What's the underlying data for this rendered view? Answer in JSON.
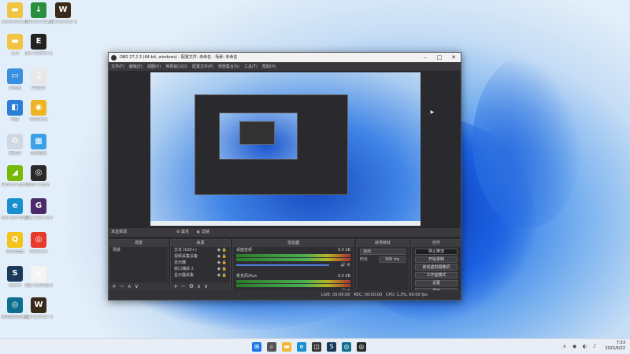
{
  "desktop": {
    "icons": [
      {
        "label": "Administrator",
        "icon": "folder-icon",
        "color": "#f2c443",
        "glyph": "▬"
      },
      {
        "label": "Internet Download...",
        "icon": "idm-icon",
        "color": "#2b8e3e",
        "glyph": "↓"
      },
      {
        "label": "Warhammer Vermintide 2",
        "icon": "game-icon",
        "color": "#3a2a1a",
        "glyph": "W"
      },
      {
        "label": "123",
        "icon": "folder-icon",
        "color": "#f2c443",
        "glyph": "▬"
      },
      {
        "label": "Epic Games Launcher",
        "icon": "epic-icon",
        "color": "#222222",
        "glyph": "E"
      },
      {
        "label": "此电脑",
        "icon": "computer-icon",
        "color": "#3b8fe0",
        "glyph": "▭"
      },
      {
        "label": "QQ音乐",
        "icon": "qq-icon",
        "color": "#e8e8e8",
        "glyph": "♫"
      },
      {
        "label": "网络",
        "icon": "network-icon",
        "color": "#2b7fd6",
        "glyph": "◧"
      },
      {
        "label": "WeGame",
        "icon": "wegame-icon",
        "color": "#f0b422",
        "glyph": "◉"
      },
      {
        "label": "回收站",
        "icon": "recycle-bin-icon",
        "color": "#cfd8e3",
        "glyph": "♻"
      },
      {
        "label": "控制面板",
        "icon": "control-panel-icon",
        "color": "#3ba0e6",
        "glyph": "▦"
      },
      {
        "label": "GeForce Experience",
        "icon": "nvidia-icon",
        "color": "#76b900",
        "glyph": "◢"
      },
      {
        "label": "OBS Studio",
        "icon": "obs-icon",
        "color": "#2a2a2a",
        "glyph": "◎"
      },
      {
        "label": "Microsoft Edge",
        "icon": "edge-icon",
        "color": "#1a8fcf",
        "glyph": "e"
      },
      {
        "label": "Grey Goo Launcher",
        "icon": "grey-goo-icon",
        "color": "#4a2a6a",
        "glyph": "G"
      },
      {
        "label": "QQ浏览器",
        "icon": "qq-browser-icon",
        "color": "#f3c31b",
        "glyph": "Q"
      },
      {
        "label": "WeGame",
        "icon": "wegame-icon",
        "color": "#e83a2a",
        "glyph": "◎"
      },
      {
        "label": "Steam",
        "icon": "steam-icon",
        "color": "#1b3a5a",
        "glyph": "S"
      },
      {
        "label": "新建 文本文档.txt",
        "icon": "text-file-icon",
        "color": "#f4f4f4",
        "glyph": "≡"
      },
      {
        "label": "腾讯游戏加速器",
        "icon": "accelerator-icon",
        "color": "#0f6e8f",
        "glyph": "◎"
      },
      {
        "label": "Warhammer Vermintide 2",
        "icon": "game-icon",
        "color": "#3a2a1a",
        "glyph": "W"
      }
    ]
  },
  "obs": {
    "title": "OBS 27.2.3 (64-bit, windows) - 配置文件: 未命名 - 场景: 未命名",
    "menu": [
      "文件(F)",
      "编辑(E)",
      "视图(V)",
      "停靠窗口(D)",
      "配置文件(P)",
      "场景集合(S)",
      "工具(T)",
      "帮助(H)"
    ],
    "no_source_label": "未选择源",
    "props_label": "属性",
    "filters_label": "滤镜",
    "docks": {
      "scenes": {
        "title": "场景",
        "items": [
          "场景"
        ]
      },
      "sources": {
        "title": "来源",
        "items": [
          "文本 (GDI+)",
          "视频采集设备",
          "显示器",
          "窗口捕获 2",
          "显示器采集"
        ]
      },
      "mixer": {
        "title": "混音器",
        "channels": [
          {
            "name": "桌面音频",
            "db": "0.0 dB"
          },
          {
            "name": "麦克风/Aux",
            "db": "0.0 dB"
          }
        ]
      },
      "transitions": {
        "title": "转场特效",
        "type": "淡出",
        "duration_label": "时长",
        "duration": "300 ms"
      },
      "controls": {
        "title": "控件",
        "buttons": [
          "停止推流",
          "开始录制",
          "启动虚拟摄像机",
          "工作室模式",
          "设置",
          "退出"
        ]
      }
    },
    "status": {
      "live": "LIVE: 00:00:00",
      "rec": "REC: 00:00:00",
      "cpu": "CPU: 1.3%, 60.00 fps"
    }
  },
  "taskbar": {
    "apps": [
      {
        "icon": "windows-start-icon",
        "color": "#1a73e8",
        "glyph": "⊞"
      },
      {
        "icon": "search-icon",
        "color": "#555555",
        "glyph": "⌕"
      },
      {
        "icon": "file-explorer-icon",
        "color": "#f2b733",
        "glyph": "▬"
      },
      {
        "icon": "edge-icon",
        "color": "#1a8fcf",
        "glyph": "e"
      },
      {
        "icon": "store-icon",
        "color": "#333333",
        "glyph": "◫"
      },
      {
        "icon": "steam-icon",
        "color": "#1b3a5a",
        "glyph": "S"
      },
      {
        "icon": "app-icon",
        "color": "#0f6e8f",
        "glyph": "◎"
      },
      {
        "icon": "obs-icon",
        "color": "#2a2a2a",
        "glyph": "◎"
      }
    ],
    "time": "7:53",
    "date": "2022/6/22"
  }
}
